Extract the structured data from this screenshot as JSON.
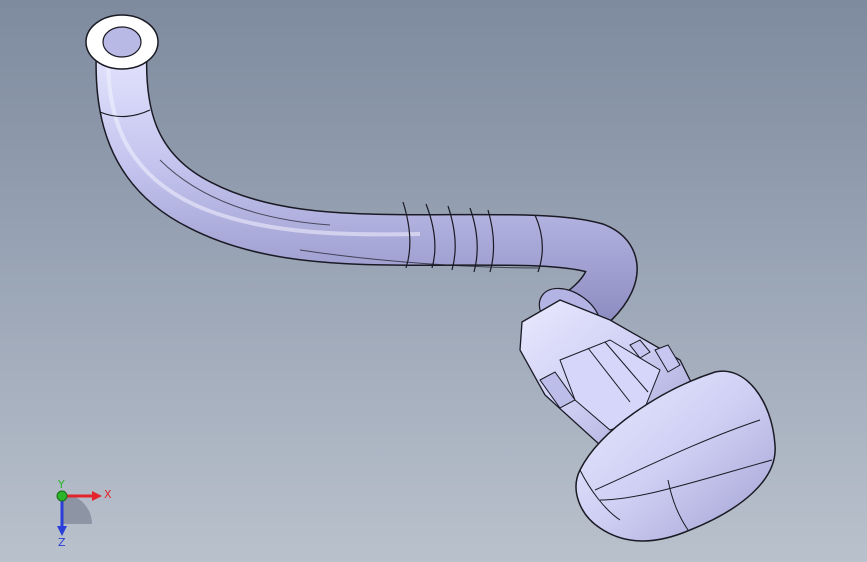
{
  "viewport": {
    "background_top": "#7e8a9e",
    "background_bottom": "#b9c1cc",
    "model_color": "#c9c9f2",
    "edge_color": "#1a1a24"
  },
  "triad": {
    "x_label": "X",
    "y_label": "Y",
    "z_label": "Z",
    "x_color": "#e3242b",
    "y_color": "#2bb52b",
    "z_color": "#2a3fd8"
  }
}
